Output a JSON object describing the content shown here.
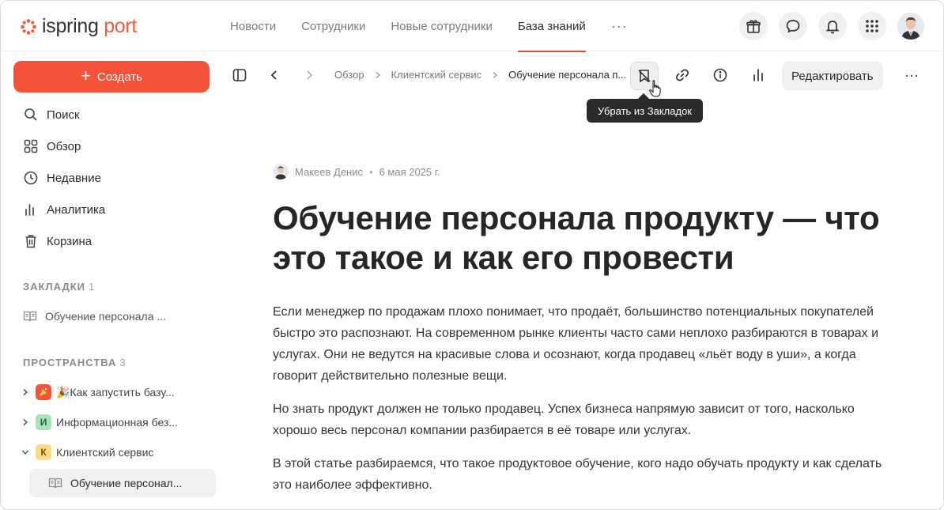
{
  "app": {
    "logo_text": "ispring",
    "logo_text_accent": "port",
    "brand_color": "#f05a3c"
  },
  "nav": {
    "items": [
      "Новости",
      "Сотрудники",
      "Новые сотрудники",
      "База знаний"
    ],
    "active": "База знаний",
    "more": "···"
  },
  "top_actions": [
    "gift-icon",
    "chat-icon",
    "bell-icon",
    "apps-grid-icon",
    "user-avatar"
  ],
  "sidebar": {
    "create_label": "Создать",
    "menu": [
      {
        "icon": "search-icon",
        "label": "Поиск"
      },
      {
        "icon": "overview-icon",
        "label": "Обзор"
      },
      {
        "icon": "clock-icon",
        "label": "Недавние"
      },
      {
        "icon": "analytics-icon",
        "label": "Аналитика"
      },
      {
        "icon": "trash-icon",
        "label": "Корзина"
      }
    ],
    "bookmarks_title": "ЗАКЛАДКИ",
    "bookmarks_count": "1",
    "bookmarks": [
      {
        "icon": "book-icon",
        "label": "Обучение персонала ..."
      }
    ],
    "spaces_title": "ПРОСТРАНСТВА",
    "spaces_count": "3",
    "spaces": [
      {
        "badge": "",
        "badge_color": "#f4533a",
        "label": "🎉Как запустить базу...",
        "expanded": false
      },
      {
        "badge": "И",
        "badge_color": "#9fe0b4",
        "label": "Информационная без...",
        "expanded": false
      },
      {
        "badge": "К",
        "badge_color": "#ffd98a",
        "label": "Клиентский сервис",
        "expanded": true
      }
    ],
    "space_child": {
      "icon": "book-icon",
      "label": "Обучение персонал..."
    }
  },
  "toolbar": {
    "breadcrumbs": [
      "Обзор",
      "Клиентский сервис",
      "Обучение персонала п..."
    ],
    "edit_label": "Редактировать",
    "tooltip": "Убрать из Закладок",
    "more": "···"
  },
  "article": {
    "author": "Макеев Денис",
    "date": "6 мая 2025 г.",
    "title": "Обучение персонала продукту — что это такое и как его провести",
    "paragraphs": [
      "Если менеджер по продажам плохо понимает, что продаёт, большинство потенциальных покупателей быстро это распознают. На современном рынке клиенты часто сами неплохо разбираются в товарах и услугах. Они не ведутся на красивые слова и осознают, когда продавец «льёт воду в уши», а когда говорит действительно полезные вещи.",
      "Но знать продукт должен не только продавец. Успех бизнеса напрямую зависит от того, насколько хорошо весь персонал компании разбирается в её товаре или услугах.",
      "В этой статье разбираемся, что такое продуктовое обучение, кого надо обучать продукту и как сделать это наиболее эффективно."
    ]
  }
}
